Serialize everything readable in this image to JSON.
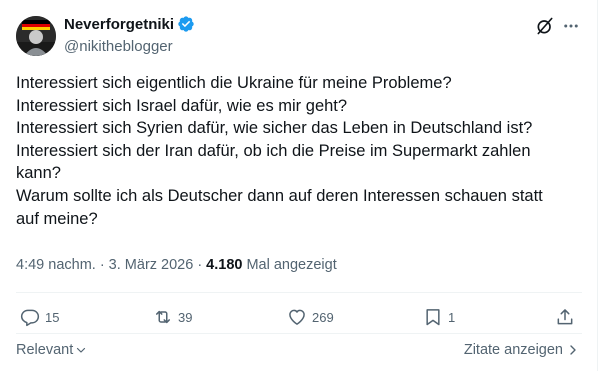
{
  "author": {
    "display_name": "Neverforgetniki",
    "handle": "@nikitheblogger",
    "verified": true
  },
  "tweet": {
    "lines": [
      "Interessiert sich eigentlich die Ukraine für meine Probleme?",
      "Interessiert sich Israel dafür, wie es mir geht?",
      "Interessiert sich Syrien dafür, wie sicher das Leben in Deutschland ist?",
      "Interessiert sich der Iran dafür, ob ich die Preise im Supermarkt zahlen",
      "kann?",
      "Warum sollte ich als Deutscher dann auf deren Interessen schauen statt",
      "auf meine?"
    ]
  },
  "meta": {
    "timestamp": "4:49 nachm. · 3. März 2026 ·",
    "views_count": "4.180",
    "views_label": "Mal angezeigt"
  },
  "actions": {
    "replies": "15",
    "reposts": "39",
    "likes": "269",
    "bookmarks": "1"
  },
  "footer": {
    "sort_label": "Relevant",
    "quotes_link": "Zitate anzeigen"
  },
  "colors": {
    "text": "#0f1419",
    "secondary": "#536471",
    "verified": "#1d9bf0",
    "divider": "#eff3f4"
  },
  "icons": [
    "verified-badge-icon",
    "grok-icon",
    "more-icon",
    "reply-icon",
    "repost-icon",
    "like-icon",
    "bookmark-icon",
    "share-icon",
    "chevron-down-icon",
    "chevron-right-icon"
  ]
}
